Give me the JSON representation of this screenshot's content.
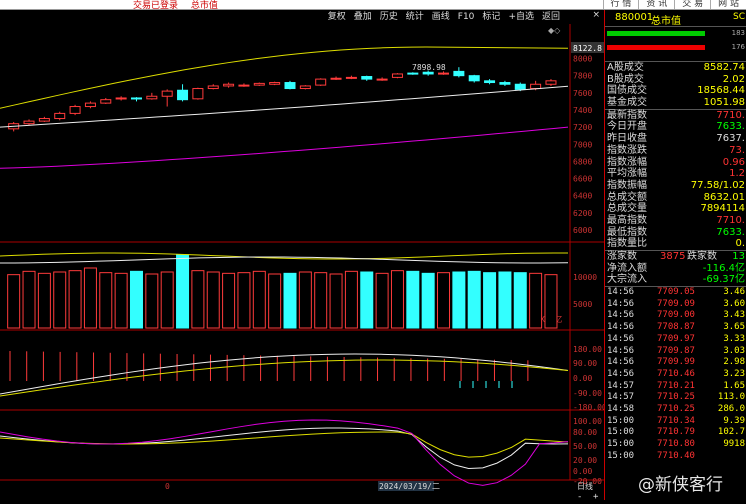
{
  "top_status": {
    "text1": "交易已登录",
    "text2": "总市值"
  },
  "top_nav": [
    "行 情",
    "资 讯",
    "交 易",
    "网 站"
  ],
  "toolbar": [
    "复权",
    "叠加",
    "历史",
    "统计",
    "画线",
    "F10",
    "标记",
    "+自选",
    "返回"
  ],
  "toolbar_close": "×",
  "ctrl_glyph": "◆◇",
  "price_axis": {
    "labels": [
      "8122.8",
      "8000",
      "7800",
      "7600",
      "7400",
      "7200",
      "7000",
      "6800",
      "6600",
      "6400",
      "6200",
      "6000"
    ]
  },
  "vol_axis": {
    "labels": [
      "10000",
      "5000",
      "X10亿"
    ]
  },
  "macd_axis": {
    "labels": [
      "180.00",
      "90.00",
      "0.00",
      "-90.00",
      "-180.00"
    ]
  },
  "kdj_axis": {
    "labels": [
      "100.00",
      "80.00",
      "50.00",
      "20.00",
      "0.00",
      "-20.00"
    ]
  },
  "chart_annotations": {
    "high_label": "7898.98",
    "date_label": "2024/03/19/二",
    "left_zero": "0"
  },
  "candles": [
    [
      7180,
      7240,
      7150,
      7260
    ],
    [
      7240,
      7270,
      7220,
      7290
    ],
    [
      7270,
      7300,
      7260,
      7320
    ],
    [
      7300,
      7360,
      7280,
      7380
    ],
    [
      7360,
      7440,
      7340,
      7460
    ],
    [
      7440,
      7480,
      7420,
      7500
    ],
    [
      7480,
      7520,
      7470,
      7540
    ],
    [
      7530,
      7540,
      7510,
      7560
    ],
    [
      7540,
      7530,
      7500,
      7550
    ],
    [
      7530,
      7560,
      7520,
      7600
    ],
    [
      7560,
      7620,
      7440,
      7640
    ],
    [
      7630,
      7520,
      7500,
      7700
    ],
    [
      7530,
      7650,
      7520,
      7660
    ],
    [
      7650,
      7680,
      7640,
      7700
    ],
    [
      7680,
      7700,
      7660,
      7720
    ],
    [
      7690,
      7690,
      7670,
      7710
    ],
    [
      7690,
      7710,
      7680,
      7720
    ],
    [
      7700,
      7720,
      7690,
      7730
    ],
    [
      7720,
      7650,
      7640,
      7740
    ],
    [
      7650,
      7680,
      7640,
      7690
    ],
    [
      7690,
      7760,
      7680,
      7770
    ],
    [
      7760,
      7770,
      7750,
      7790
    ],
    [
      7770,
      7780,
      7760,
      7800
    ],
    [
      7790,
      7760,
      7740,
      7800
    ],
    [
      7760,
      7760,
      7740,
      7780
    ],
    [
      7780,
      7820,
      7770,
      7830
    ],
    [
      7830,
      7820,
      7810,
      7840
    ],
    [
      7840,
      7820,
      7800,
      7860
    ],
    [
      7830,
      7830,
      7810,
      7850
    ],
    [
      7850,
      7800,
      7780,
      7898.98
    ],
    [
      7800,
      7740,
      7720,
      7810
    ],
    [
      7740,
      7720,
      7700,
      7760
    ],
    [
      7720,
      7700,
      7680,
      7740
    ],
    [
      7700,
      7640,
      7620,
      7720
    ],
    [
      7650,
      7700,
      7630,
      7740
    ],
    [
      7700,
      7740,
      7680,
      7760
    ]
  ],
  "volumes": [
    8000,
    8500,
    8200,
    8400,
    8600,
    9000,
    8300,
    8200,
    8500,
    8100,
    8400,
    11000,
    8600,
    8400,
    8200,
    8300,
    8500,
    8100,
    8200,
    8400,
    8300,
    8100,
    8500,
    8400,
    8200,
    8600,
    8500,
    8200,
    8300,
    8400,
    8500,
    8300,
    8400,
    8300,
    8200,
    8000
  ],
  "side": {
    "code": "880001",
    "name": "总市值",
    "right_tag": "SC",
    "bar_nums": [
      "183",
      "176"
    ],
    "rows1": [
      {
        "k": "A股成交",
        "v": "8582.74",
        "c": "#ff0"
      },
      {
        "k": "B股成交",
        "v": "2.02",
        "c": "#ff0"
      },
      {
        "k": "国债成交",
        "v": "18568.44",
        "c": "#ff0"
      },
      {
        "k": "基金成交",
        "v": "1051.98",
        "c": "#ff0"
      }
    ],
    "rows2": [
      {
        "k": "最新指数",
        "v": "7710.",
        "c": "#f33"
      },
      {
        "k": "今日开盘",
        "v": "7633.",
        "c": "#0f0"
      },
      {
        "k": "昨日收盘",
        "v": "7637.",
        "c": "#ddd"
      },
      {
        "k": "指数涨跌",
        "v": "73.",
        "c": "#f33"
      },
      {
        "k": "指数涨幅",
        "v": "0.96",
        "c": "#f33"
      },
      {
        "k": "平均涨幅",
        "v": "1.2",
        "c": "#f33"
      },
      {
        "k": "指数振幅",
        "v": "77.58/1.02",
        "c": "#ff0"
      },
      {
        "k": "总成交额",
        "v": "8632.01",
        "c": "#ff0"
      },
      {
        "k": "总成交量",
        "v": "7894114",
        "c": "#ff0"
      },
      {
        "k": "最高指数",
        "v": "7710.",
        "c": "#f33"
      },
      {
        "k": "最低指数",
        "v": "7633.",
        "c": "#0f0"
      },
      {
        "k": "指数量比",
        "v": "0.",
        "c": "#ff0"
      }
    ],
    "updown": {
      "k1": "涨家数",
      "v1": "3875",
      "k2": "跌家数",
      "v2": "13"
    },
    "flows": [
      {
        "k": "净流入额",
        "v": "-116.4亿",
        "c": "#0f0"
      },
      {
        "k": "大宗流入",
        "v": "-69.37亿",
        "c": "#0f0"
      }
    ],
    "ticks": [
      [
        "14:56",
        "7709.05",
        "3.46"
      ],
      [
        "14:56",
        "7709.09",
        "3.60"
      ],
      [
        "14:56",
        "7709.00",
        "3.43"
      ],
      [
        "14:56",
        "7708.87",
        "3.65"
      ],
      [
        "14:56",
        "7709.97",
        "3.33"
      ],
      [
        "14:56",
        "7709.87",
        "3.03"
      ],
      [
        "14:56",
        "7709.99",
        "2.98"
      ],
      [
        "14:56",
        "7710.46",
        "3.23"
      ],
      [
        "14:57",
        "7710.21",
        "1.65"
      ],
      [
        "14:57",
        "7710.25",
        "113.0"
      ],
      [
        "14:58",
        "7710.25",
        "286.0"
      ],
      [
        "15:00",
        "7710.34",
        "9.39"
      ],
      [
        "15:00",
        "7710.79",
        "102.7"
      ],
      [
        "15:00",
        "7710.80",
        "9918"
      ],
      [
        "15:00",
        "7710.40",
        ""
      ]
    ]
  },
  "bottom": {
    "minus": "-",
    "plus": "+",
    "page": "日线"
  },
  "watermark": "@新侠客行"
}
